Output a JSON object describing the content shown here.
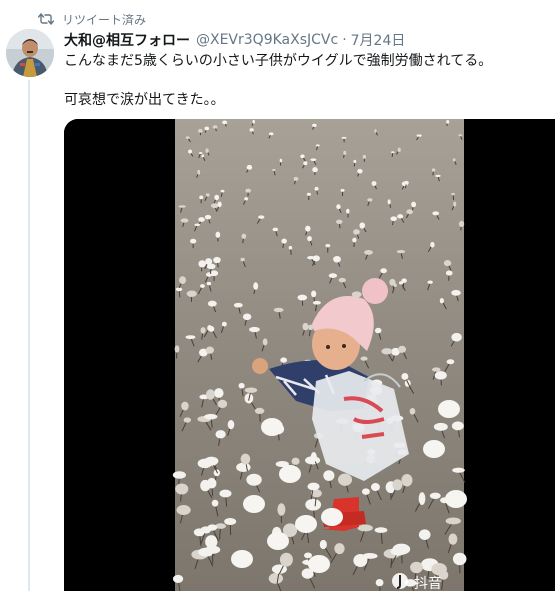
{
  "retweet": {
    "icon": "retweet-icon",
    "label": "リツイート済み"
  },
  "tweet": {
    "author": {
      "display_name": "大和@相互フォロー",
      "handle": "@XEVr3Q9KaXsJCVc",
      "avatar_icon": "avatar"
    },
    "separator": "·",
    "date": "7月24日",
    "text_lines": [
      "こんなまだ5歳くらいの小さい子供がウイグルで強制労働されてる。",
      "可哀想で涙が出てきた。。"
    ]
  },
  "media": {
    "kind": "video",
    "watermark": "抖音"
  },
  "colors": {
    "secondary_text": "#657786",
    "primary_text": "#14171a",
    "thread_line": "#e1e8ed",
    "letterbox": "#000000",
    "cotton_field": "#8f8980",
    "hat": "#f2c9cd",
    "pants": "#d8342c"
  }
}
